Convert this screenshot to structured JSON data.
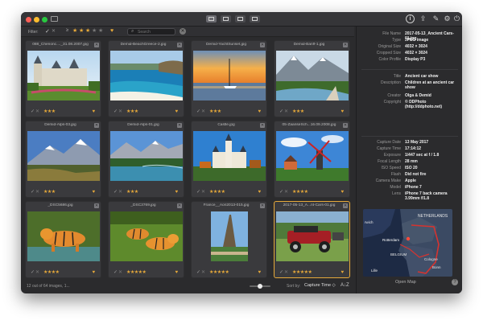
{
  "colors": {
    "accent": "#e6a93a",
    "window": "#2b2b2d"
  },
  "filter": {
    "label": "Filter:",
    "check": "✓",
    "cross": "✕",
    "pick": "≥",
    "stars_on": 3,
    "stars_total": 5,
    "heart": "♥",
    "search_placeholder": "Search",
    "clear": "✕"
  },
  "thumbs": [
    {
      "name": "088_Chenonc...._31.08.2007.jpg",
      "rating": 3,
      "cross": false
    },
    {
      "name": "Demid-BeachGreece-2.jpg",
      "rating": 3,
      "cross": false
    },
    {
      "name": "Demid-YachtSunset.jpg",
      "rating": 3,
      "cross": false
    },
    {
      "name": "Demid-Banff-1.jpg",
      "rating": 3,
      "cross": false
    },
    {
      "name": "Demid-Alps-03.jpg",
      "rating": 3,
      "cross": true
    },
    {
      "name": "Demid-Alps-01.jpg",
      "rating": 3,
      "cross": true
    },
    {
      "name": "Castle.jpg",
      "rating": 4,
      "cross": false
    },
    {
      "name": "05-ZaanseSch...16.09.2008.jpg",
      "rating": 4,
      "cross": true
    },
    {
      "name": "_DSC5686.jpg",
      "rating": 4,
      "cross": false
    },
    {
      "name": "_DSC3769.jpg",
      "rating": 5,
      "cross": true
    },
    {
      "name": "France__Aori2013-015.jpg",
      "rating": 5,
      "cross": true
    },
    {
      "name": "2017-05-13_A...nt-Cars-01.jpg",
      "rating": 5,
      "cross": true
    }
  ],
  "status": {
    "count": "12 out of 64 images, 1...",
    "sort_label": "Sort by:",
    "sort_value": "Capture Time ◇",
    "az": "A↓Z"
  },
  "inspector": {
    "rows": [
      {
        "k": "File Name",
        "v": "2017-05-13_Ancient Cars-01.jpg"
      },
      {
        "k": "Type",
        "v": "JPEG image"
      },
      {
        "k": "Original Size",
        "v": "4032 × 3024"
      },
      {
        "k": "Cropped Size",
        "v": "4032 × 3024"
      },
      {
        "k": "Color Profile",
        "v": "Display P3"
      },
      {
        "k": "Title",
        "v": "Ancient car show"
      },
      {
        "k": "Description",
        "v": "Children at an ancient car show"
      },
      {
        "k": "Creator",
        "v": "Olga & Demid"
      },
      {
        "k": "Copyright",
        "v": "© DDPhoto (http://ddphoto.net)"
      },
      {
        "k": "Capture Date",
        "v": "13 May 2017"
      },
      {
        "k": "Capture Time",
        "v": "17:14:12"
      },
      {
        "k": "Exposure",
        "v": "1/447 sec at f / 1.8"
      },
      {
        "k": "Focal Length",
        "v": "28 mm"
      },
      {
        "k": "ISO Speed",
        "v": "ISO 20"
      },
      {
        "k": "Flash",
        "v": "Did not fire"
      },
      {
        "k": "Camera Make",
        "v": "Apple"
      },
      {
        "k": "Model",
        "v": "iPhone 7"
      },
      {
        "k": "Lens",
        "v": "iPhone 7 back camera 3.99mm f/1.8"
      }
    ],
    "map_labels": {
      "nl": "NETHERLANDS",
      "rotterdam": "Rotterdam",
      "norwich": "rwich",
      "belgium": "BELGIUM",
      "lille": "Lille",
      "cologne": "Cologne",
      "bonn": "Bonn"
    },
    "open_map": "Open Map",
    "help": "?"
  }
}
